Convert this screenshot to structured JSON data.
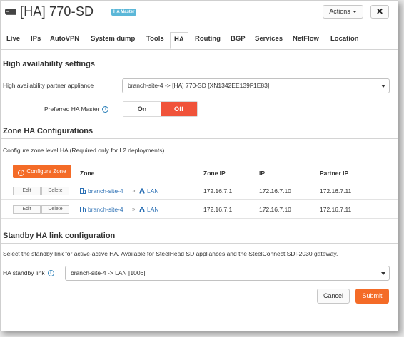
{
  "header": {
    "title": "[HA] 770-SD",
    "badge": "HA Master",
    "actions_label": "Actions",
    "close_label": "✕"
  },
  "tabs": [
    {
      "label": "Live"
    },
    {
      "label": "IPs"
    },
    {
      "label": "AutoVPN"
    },
    {
      "label": "System dump"
    },
    {
      "label": "Tools"
    },
    {
      "label": "HA",
      "active": true
    },
    {
      "label": "Routing"
    },
    {
      "label": "BGP"
    },
    {
      "label": "Services"
    },
    {
      "label": "NetFlow"
    },
    {
      "label": "Location"
    }
  ],
  "ha_settings": {
    "title": "High availability settings",
    "partner_label": "High availability partner appliance",
    "partner_value": "branch-site-4 -> [HA] 770-SD [XN1342EE139F1E83]",
    "preferred_label": "Preferred HA Master",
    "toggle_on": "On",
    "toggle_off": "Off",
    "selected": "Off"
  },
  "zone_ha": {
    "title": "Zone HA Configurations",
    "description": "Configure zone level HA (Required only for L2 deployments)",
    "configure_button": "Configure Zone",
    "columns": [
      "Zone",
      "Zone IP",
      "IP",
      "Partner IP"
    ],
    "edit_label": "Edit",
    "delete_label": "Delete",
    "rows": [
      {
        "site": "branch-site-4",
        "zone": "LAN",
        "zone_ip": "172.16.7.1",
        "ip": "172.16.7.10",
        "partner_ip": "172.16.7.11"
      },
      {
        "site": "branch-site-4",
        "zone": "LAN",
        "zone_ip": "172.16.7.1",
        "ip": "172.16.7.10",
        "partner_ip": "172.16.7.11"
      }
    ]
  },
  "standby": {
    "title": "Standby HA link configuration",
    "description": "Select the standby link for active-active HA. Available for SteelHead SD appliances and the SteelConnect SDI-2030 gateway.",
    "link_label": "HA standby link",
    "link_value": "branch-site-4 -> LAN [1006]"
  },
  "footer": {
    "cancel_label": "Cancel",
    "submit_label": "Submit"
  },
  "colors": {
    "accent": "#f46b27",
    "toggle_active": "#f0533a",
    "badge": "#5bb7d8",
    "link": "#2a6fb4"
  }
}
